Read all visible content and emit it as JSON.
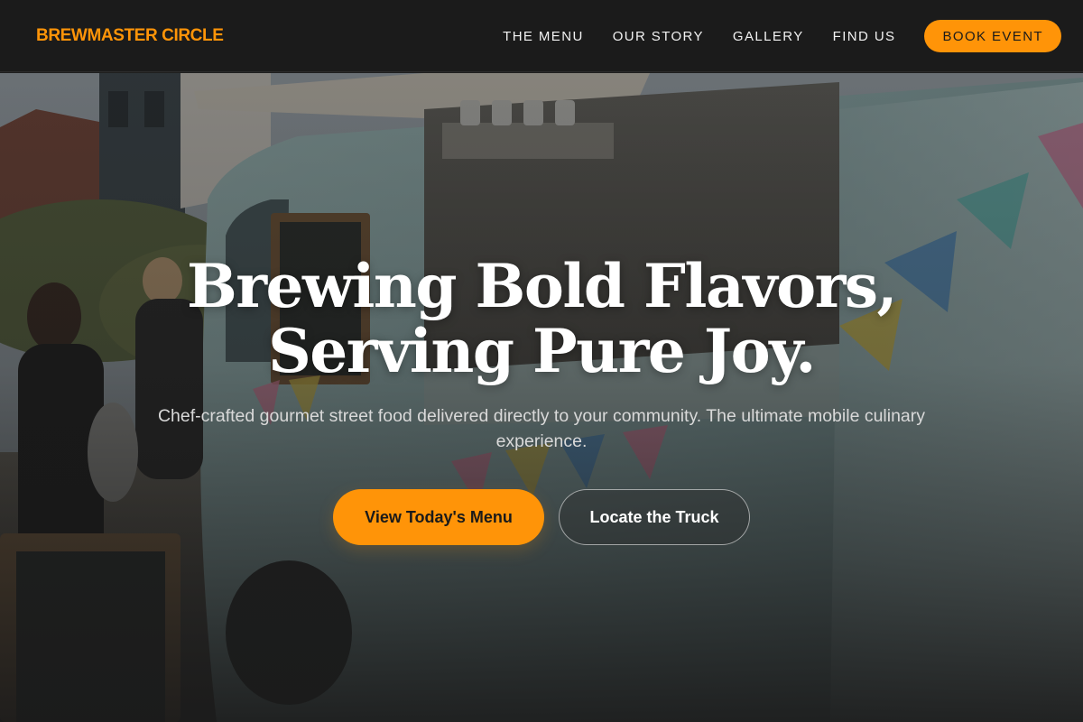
{
  "brand": {
    "name": "BREWMASTER CIRCLE",
    "color": "#ff9408"
  },
  "nav": {
    "links": [
      "THE MENU",
      "OUR STORY",
      "GALLERY",
      "FIND US"
    ],
    "cta": "BOOK EVENT"
  },
  "hero": {
    "headline_line1": "Brewing Bold Flavors,",
    "headline_line2": "Serving Pure Joy.",
    "subhead": "Chef-crafted gourmet street food delivered directly to your community. The ultimate mobile culinary experience.",
    "primary_cta": "View Today's Menu",
    "secondary_cta": "Locate the Truck",
    "background": "food-truck-photo"
  },
  "colors": {
    "accent": "#ff9408",
    "nav_bg": "#1b1b1b",
    "text_light": "#ffffff"
  }
}
